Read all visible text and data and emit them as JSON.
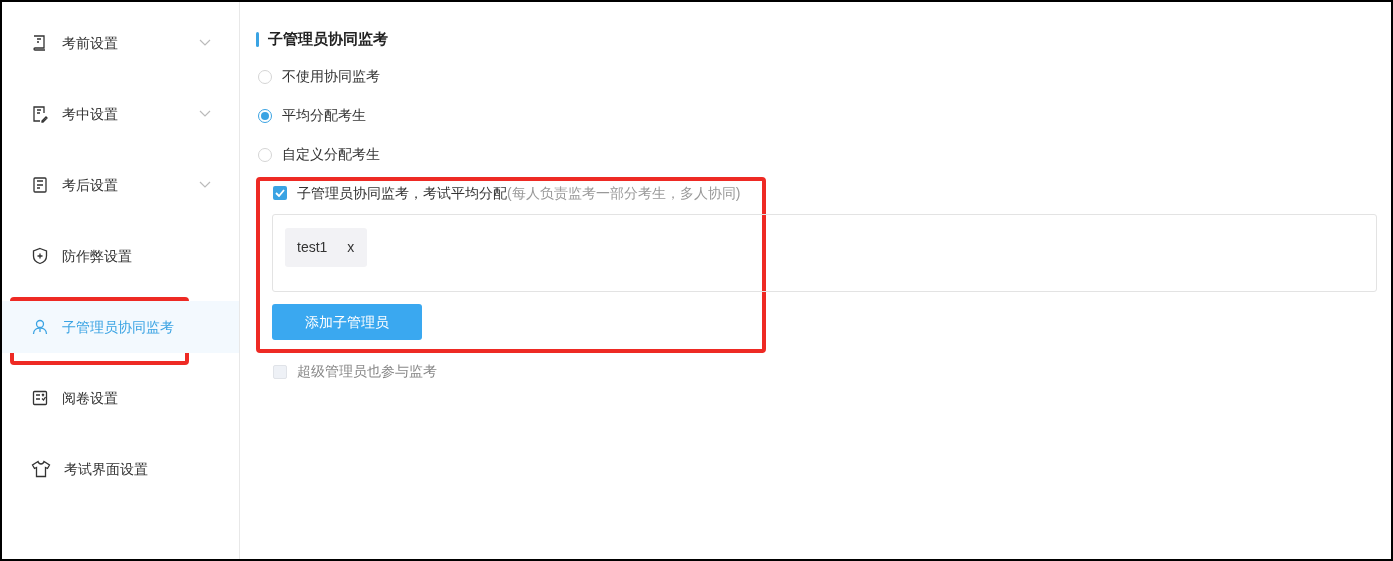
{
  "sidebar": {
    "items": [
      {
        "label": "考前设置",
        "has_chevron": true,
        "selected": false,
        "highlighted": false
      },
      {
        "label": "考中设置",
        "has_chevron": true,
        "selected": false,
        "highlighted": false
      },
      {
        "label": "考后设置",
        "has_chevron": true,
        "selected": false,
        "highlighted": false
      },
      {
        "label": "防作弊设置",
        "has_chevron": false,
        "selected": false,
        "highlighted": false
      },
      {
        "label": "子管理员协同监考",
        "has_chevron": false,
        "selected": true,
        "highlighted": true
      },
      {
        "label": "阅卷设置",
        "has_chevron": false,
        "selected": false,
        "highlighted": false
      },
      {
        "label": "考试界面设置",
        "has_chevron": false,
        "selected": false,
        "highlighted": false
      }
    ]
  },
  "section": {
    "title": "子管理员协同监考",
    "radios": [
      {
        "label": "不使用协同监考",
        "selected": false
      },
      {
        "label": "平均分配考生",
        "selected": true
      },
      {
        "label": "自定义分配考生",
        "selected": false
      }
    ],
    "highlighted": true,
    "assign_option": {
      "label": "子管理员协同监考，考试平均分配",
      "hint": "(每人负责监考一部分考生，多人协同)",
      "checked": true
    },
    "tags": [
      {
        "label": "test1",
        "remove": "x"
      }
    ],
    "add_button": "添加子管理员",
    "super_admin_option": {
      "label": "超级管理员也参与监考",
      "checked": false,
      "disabled": true
    }
  }
}
